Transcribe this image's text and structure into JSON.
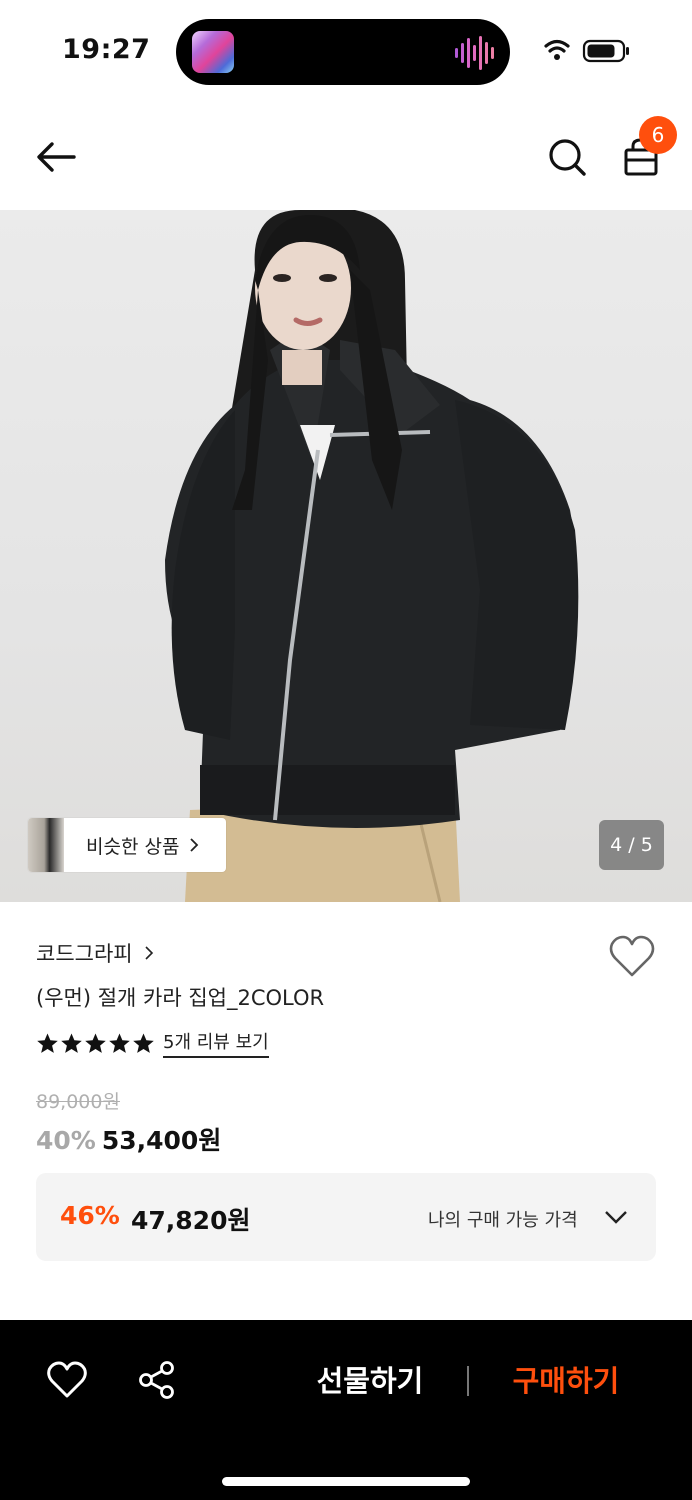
{
  "status_bar": {
    "time": "19:27"
  },
  "header": {
    "cart_count": "6"
  },
  "hero": {
    "similar_label": "비슷한 상품",
    "page_indicator": "4 / 5"
  },
  "product": {
    "brand": "코드그라피",
    "name": "(우먼) 절개 카라 집업_2COLOR",
    "rating_stars": 5,
    "review_link": "5개 리뷰 보기",
    "original_price": "89,000원",
    "discount": "40%",
    "sale_price": "53,400원"
  },
  "my_price": {
    "discount": "46%",
    "price": "47,820원",
    "label": "나의 구매 가능 가격"
  },
  "bottom_bar": {
    "gift_label": "선물하기",
    "buy_label": "구매하기"
  },
  "colors": {
    "accent": "#ff4f0d",
    "bottom_bar_bg": "#000000"
  }
}
